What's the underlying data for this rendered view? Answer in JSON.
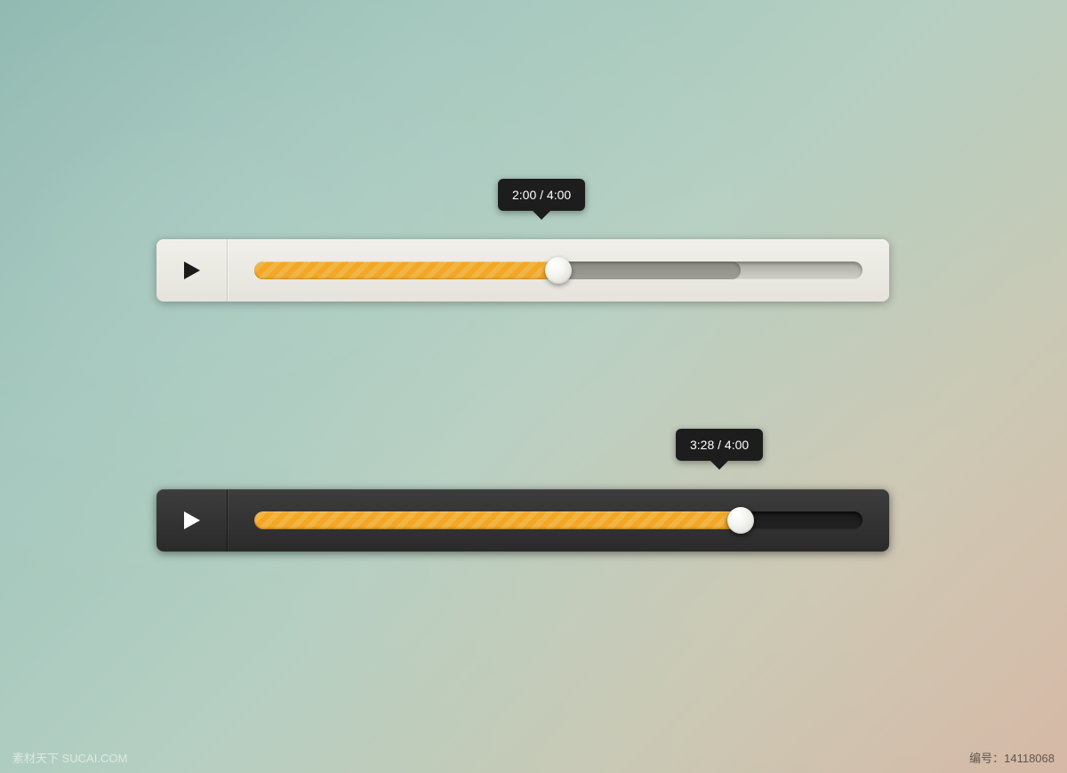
{
  "players": {
    "light": {
      "tooltip": "2:00 / 4:00",
      "progress_percent": 50,
      "buffer_percent": 80
    },
    "dark": {
      "tooltip": "3:28 / 4:00",
      "progress_percent": 80
    }
  },
  "watermark": "素材天下 SUCAI.COM",
  "meta_id": "编号：14118068"
}
